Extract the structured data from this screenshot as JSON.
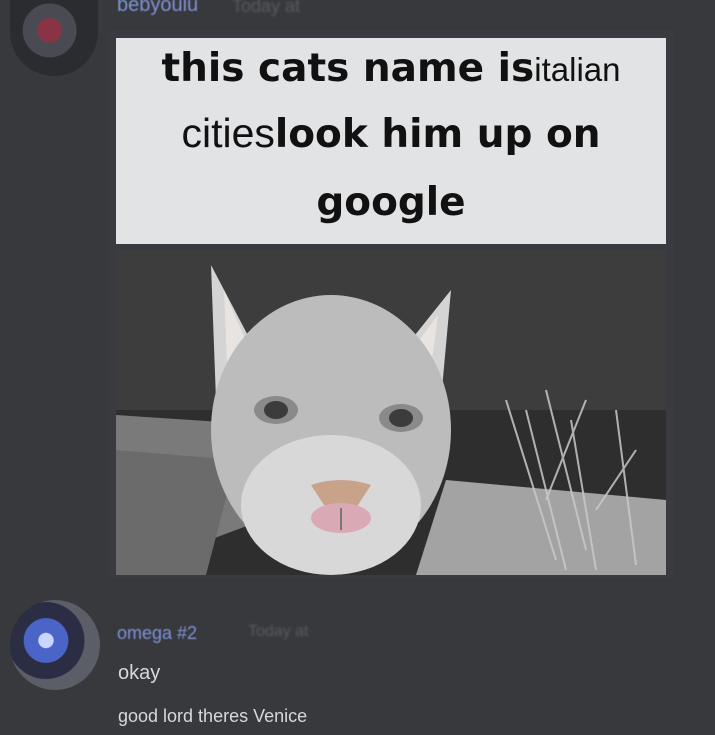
{
  "messages": [
    {
      "username": "bebyoulu",
      "timestamp": "Today at",
      "image_caption": {
        "line1_bold": "this cats name is",
        "line1_regular": "italian",
        "line2_regular": "cities",
        "line2_bold": "look him up on",
        "line3_bold": "google"
      }
    },
    {
      "username": "omega #2",
      "timestamp": "Today at",
      "lines": [
        "okay",
        "good lord theres Venice"
      ]
    }
  ],
  "colors": {
    "background": "#38393d",
    "username": "#7f93d9",
    "message_text": "#d7d8db"
  }
}
